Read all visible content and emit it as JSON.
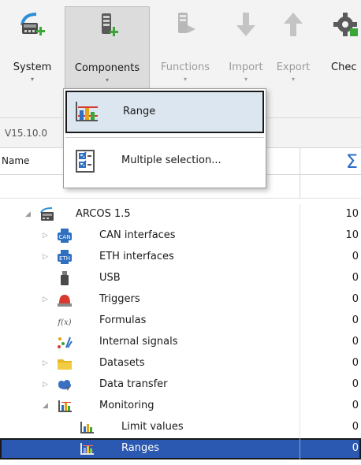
{
  "ribbon": {
    "buttons": [
      {
        "label": "System",
        "icon": "system-icon",
        "state": "normal"
      },
      {
        "label": "Components",
        "icon": "components-icon",
        "state": "active"
      },
      {
        "label": "Functions",
        "icon": "functions-icon",
        "state": "disabled"
      },
      {
        "label": "Import",
        "icon": "import-arrow-down-icon",
        "state": "disabled"
      },
      {
        "label": "Export",
        "icon": "export-arrow-up-icon",
        "state": "disabled"
      },
      {
        "label": "Chec",
        "icon": "gear-icon",
        "state": "normal"
      }
    ],
    "dropdown_arrow": "▾"
  },
  "version": {
    "text": "V15.10.0"
  },
  "table_header": {
    "name": "Name",
    "sigma": "Σ"
  },
  "dropdown_menu": {
    "items": [
      {
        "label": "Range",
        "icon": "range-chart-icon",
        "highlighted": true
      },
      {
        "label": "Multiple selection...",
        "icon": "multiple-selection-checklist-icon",
        "highlighted": false
      }
    ]
  },
  "tree": {
    "rows": [
      {
        "label": "ARCOS 1.5",
        "value": "10",
        "icon": "device-icon",
        "expander": "expanded"
      },
      {
        "label": "CAN interfaces",
        "value": "10",
        "icon": "can-interface-icon",
        "expander": "collapsed"
      },
      {
        "label": "ETH interfaces",
        "value": "0",
        "icon": "eth-interface-icon",
        "expander": "collapsed"
      },
      {
        "label": "USB",
        "value": "0",
        "icon": "usb-icon",
        "expander": "none"
      },
      {
        "label": "Triggers",
        "value": "0",
        "icon": "trigger-icon",
        "expander": "collapsed"
      },
      {
        "label": "Formulas",
        "value": "0",
        "icon": "formula-icon",
        "expander": "none"
      },
      {
        "label": "Internal signals",
        "value": "0",
        "icon": "internal-signals-icon",
        "expander": "none"
      },
      {
        "label": "Datasets",
        "value": "0",
        "icon": "folder-icon",
        "expander": "collapsed"
      },
      {
        "label": "Data transfer",
        "value": "0",
        "icon": "data-transfer-cloud-icon",
        "expander": "collapsed"
      },
      {
        "label": "Monitoring",
        "value": "0",
        "icon": "monitoring-icon",
        "expander": "expanded"
      },
      {
        "label": "Limit values",
        "value": "0",
        "icon": "limit-values-icon",
        "expander": "none"
      },
      {
        "label": "Ranges",
        "value": "0",
        "icon": "range-chart-icon",
        "expander": "none",
        "selected": true
      }
    ]
  },
  "colors": {
    "selection": "#2b58b0",
    "accent_green": "#3aa635",
    "sigma_blue": "#2b6cc4",
    "menu_highlight": "#dce6f0"
  }
}
